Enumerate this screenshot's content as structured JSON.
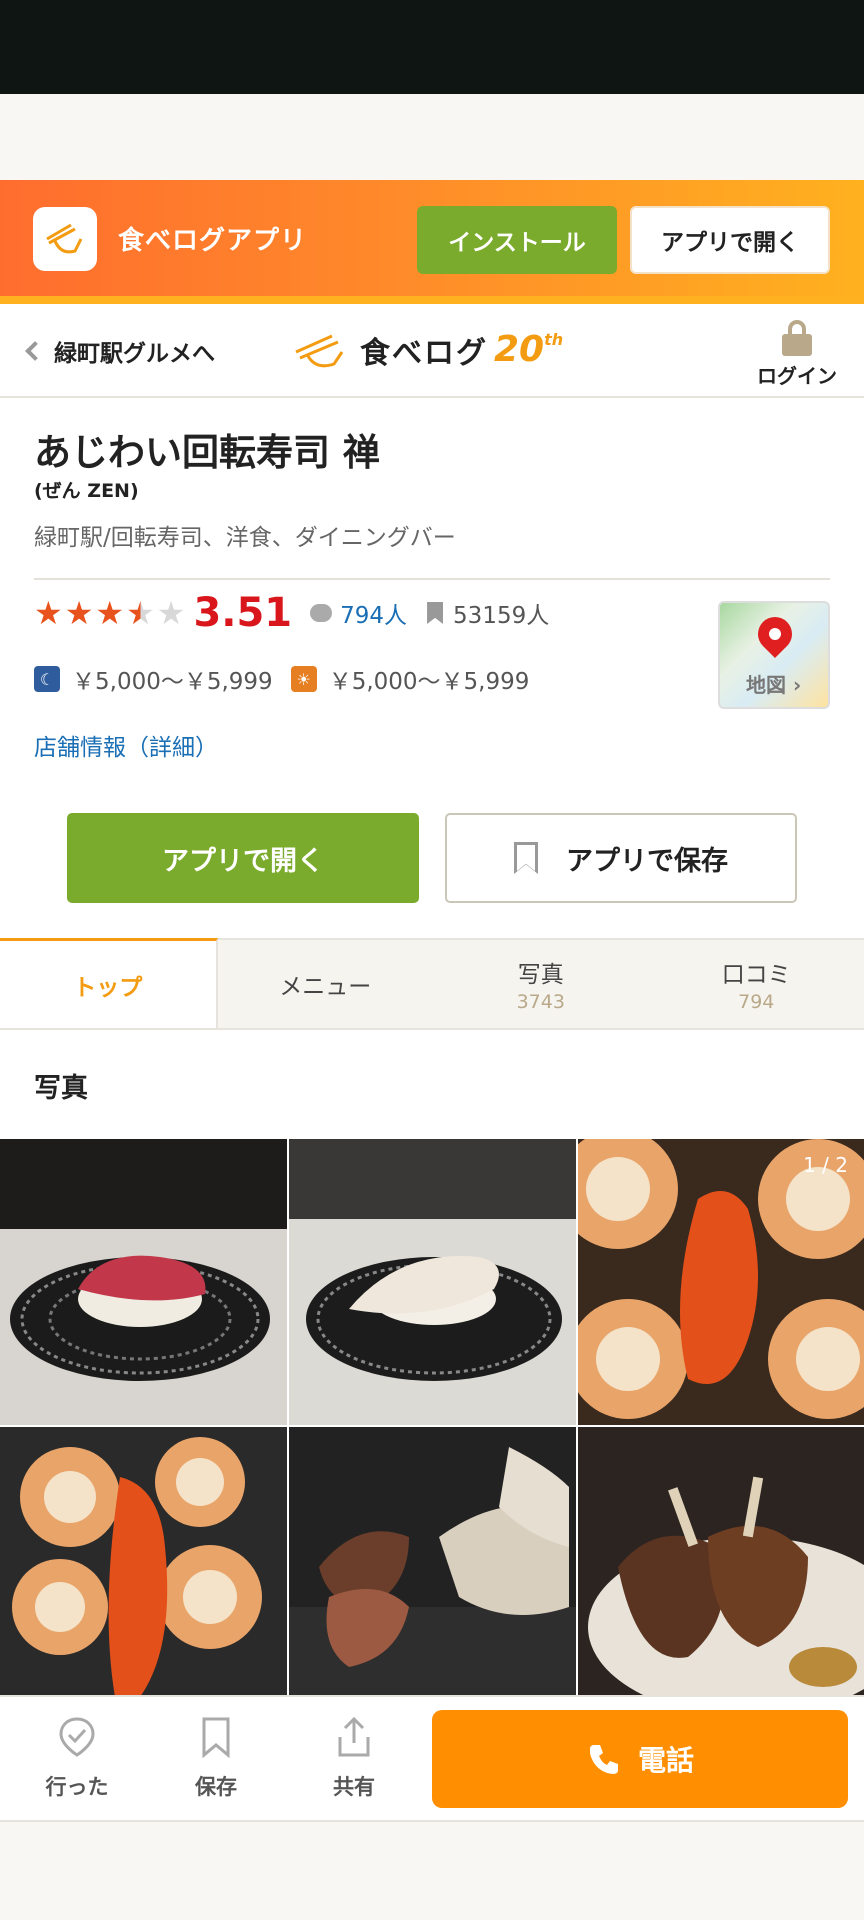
{
  "banner": {
    "app_name": "食べログアプリ",
    "install_label": "インストール",
    "open_app_label": "アプリで開く"
  },
  "header": {
    "back_label": "緑町駅グルメへ",
    "logo_text": "食べログ",
    "logo_anniversary": "20",
    "logo_anniversary_suffix": "th",
    "login_label": "ログイン"
  },
  "restaurant": {
    "name": "あじわい回転寿司 禅",
    "reading": "(ぜん ZEN)",
    "category": "緑町駅/回転寿司、洋食、ダイニングバー",
    "rating": "3.51",
    "rating_value": 3.5,
    "rating_max": 5,
    "reviews": "794人",
    "bookmarks": "53159人",
    "dinner_price": "￥5,000～￥5,999",
    "lunch_price": "￥5,000～￥5,999",
    "map_label": "地図",
    "detail_link": "店舗情報（詳細）",
    "open_app_button": "アプリで開く",
    "save_app_button": "アプリで保存"
  },
  "tabs": [
    {
      "label": "トップ",
      "count": ""
    },
    {
      "label": "メニュー",
      "count": ""
    },
    {
      "label": "写真",
      "count": "3743"
    },
    {
      "label": "口コミ",
      "count": "794"
    }
  ],
  "photos": {
    "heading": "写真",
    "page_indicator": "1 / 2"
  },
  "bottom_bar": {
    "went_label": "行った",
    "save_label": "保存",
    "share_label": "共有",
    "phone_label": "電話"
  },
  "colors": {
    "accent_orange": "#ff8f00",
    "green": "#7aab2c",
    "rating_red": "#d8161b",
    "link_blue": "#1b6fb5"
  }
}
